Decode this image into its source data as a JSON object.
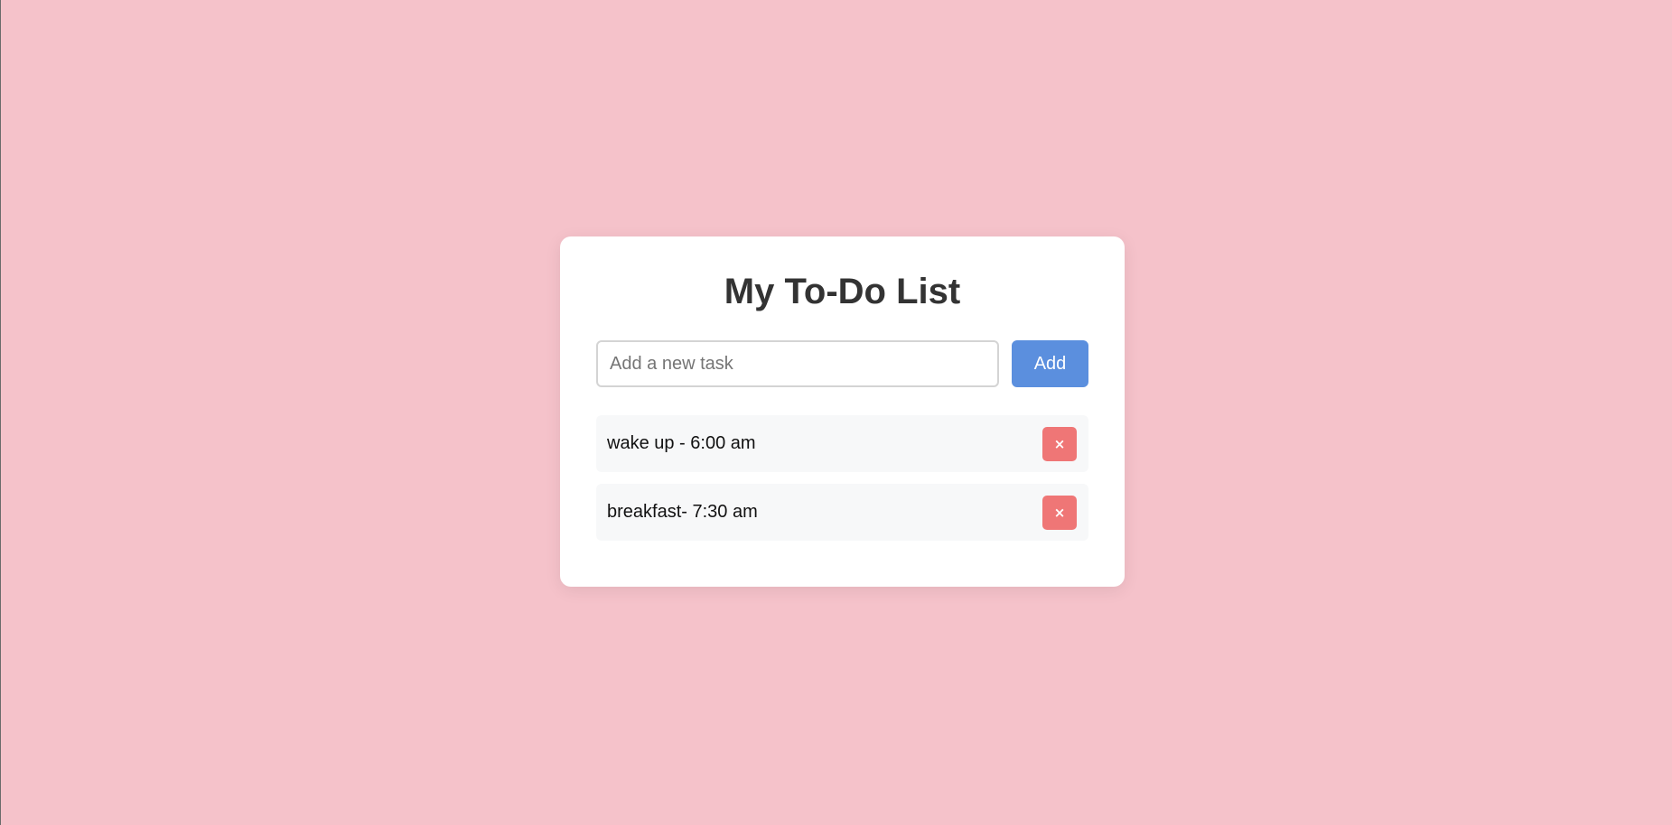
{
  "app": {
    "title": "My To-Do List"
  },
  "colors": {
    "background": "#f5c2ca",
    "card": "#ffffff",
    "add_button": "#5b8fde",
    "delete_button": "#ef7676",
    "task_bg": "#f7f8f9"
  },
  "input": {
    "value": "",
    "placeholder": "Add a new task"
  },
  "add_button": {
    "label": "Add"
  },
  "tasks": [
    {
      "text": "wake up - 6:00 am",
      "delete_label": "×",
      "delete_icon": "close-icon"
    },
    {
      "text": "breakfast- 7:30 am",
      "delete_label": "×",
      "delete_icon": "close-icon"
    }
  ]
}
